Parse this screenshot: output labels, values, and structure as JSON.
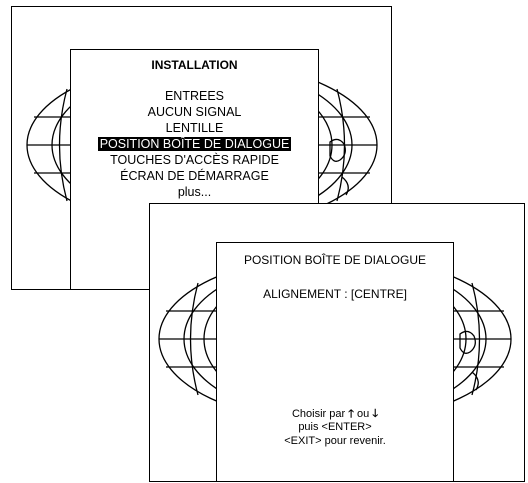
{
  "menu1": {
    "title": "INSTALLATION",
    "items": [
      {
        "label": "ENTREES"
      },
      {
        "label": "AUCUN SIGNAL"
      },
      {
        "label": "LENTILLE"
      },
      {
        "label": "POSITION BOÎTE DE DIALOGUE",
        "selected": true
      },
      {
        "label": "TOUCHES D'ACCÈS RAPIDE"
      },
      {
        "label": "ÉCRAN DE DÉMARRAGE"
      },
      {
        "label": "plus..."
      }
    ]
  },
  "dialog": {
    "title": "POSITION BOÎTE DE DIALOGUE",
    "setting_label": "ALIGNEMENT",
    "setting_separator": ":",
    "setting_value": "[CENTRE]",
    "help_line1_prefix": "Choisir par",
    "help_up_arrow": "🡑",
    "help_line1_or": "ou",
    "help_down_arrow": "🡓",
    "help_line2": "puis <ENTER>",
    "help_line3": "<EXIT> pour revenir."
  }
}
